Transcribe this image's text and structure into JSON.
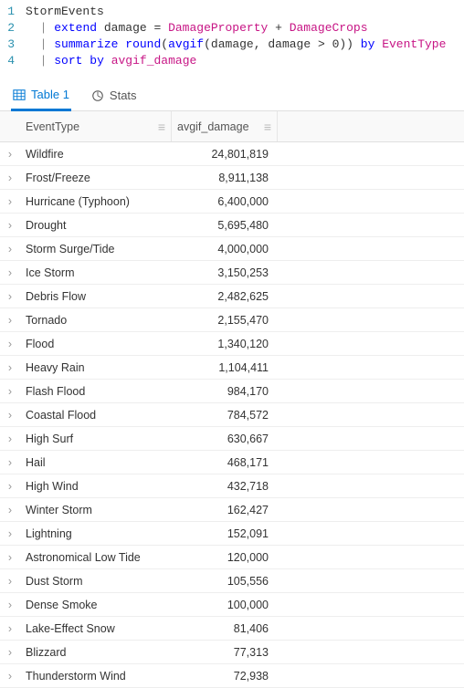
{
  "code": {
    "lines": [
      {
        "num": "1",
        "tokens": [
          {
            "t": "StormEvents",
            "c": "tok-table"
          }
        ]
      },
      {
        "num": "2",
        "tokens": [
          {
            "t": "  ",
            "c": ""
          },
          {
            "t": "|",
            "c": "tok-pipe"
          },
          {
            "t": " ",
            "c": ""
          },
          {
            "t": "extend",
            "c": "tok-kw"
          },
          {
            "t": " ",
            "c": ""
          },
          {
            "t": "damage",
            "c": "tok-param"
          },
          {
            "t": " = ",
            "c": "tok-op"
          },
          {
            "t": "DamageProperty",
            "c": "tok-col"
          },
          {
            "t": " + ",
            "c": "tok-op"
          },
          {
            "t": "DamageCrops",
            "c": "tok-col"
          }
        ]
      },
      {
        "num": "3",
        "tokens": [
          {
            "t": "  ",
            "c": ""
          },
          {
            "t": "|",
            "c": "tok-pipe"
          },
          {
            "t": " ",
            "c": ""
          },
          {
            "t": "summarize",
            "c": "tok-kw"
          },
          {
            "t": " ",
            "c": ""
          },
          {
            "t": "round",
            "c": "tok-fn"
          },
          {
            "t": "(",
            "c": "tok-op"
          },
          {
            "t": "avgif",
            "c": "tok-fn"
          },
          {
            "t": "(",
            "c": "tok-op"
          },
          {
            "t": "damage",
            "c": "tok-param"
          },
          {
            "t": ", ",
            "c": "tok-op"
          },
          {
            "t": "damage",
            "c": "tok-param"
          },
          {
            "t": " > ",
            "c": "tok-op"
          },
          {
            "t": "0",
            "c": "tok-num"
          },
          {
            "t": ")) ",
            "c": "tok-op"
          },
          {
            "t": "by",
            "c": "tok-by"
          },
          {
            "t": " ",
            "c": ""
          },
          {
            "t": "EventType",
            "c": "tok-col"
          }
        ]
      },
      {
        "num": "4",
        "tokens": [
          {
            "t": "  ",
            "c": ""
          },
          {
            "t": "|",
            "c": "tok-pipe"
          },
          {
            "t": " ",
            "c": ""
          },
          {
            "t": "sort",
            "c": "tok-kw"
          },
          {
            "t": " ",
            "c": ""
          },
          {
            "t": "by",
            "c": "tok-by"
          },
          {
            "t": " ",
            "c": ""
          },
          {
            "t": "avgif_damage",
            "c": "tok-col"
          }
        ]
      }
    ]
  },
  "tabs": {
    "table_label": "Table 1",
    "stats_label": "Stats"
  },
  "columns": {
    "event": "EventType",
    "damage": "avgif_damage"
  },
  "rows": [
    {
      "event": "Wildfire",
      "damage": "24,801,819"
    },
    {
      "event": "Frost/Freeze",
      "damage": "8,911,138"
    },
    {
      "event": "Hurricane (Typhoon)",
      "damage": "6,400,000"
    },
    {
      "event": "Drought",
      "damage": "5,695,480"
    },
    {
      "event": "Storm Surge/Tide",
      "damage": "4,000,000"
    },
    {
      "event": "Ice Storm",
      "damage": "3,150,253"
    },
    {
      "event": "Debris Flow",
      "damage": "2,482,625"
    },
    {
      "event": "Tornado",
      "damage": "2,155,470"
    },
    {
      "event": "Flood",
      "damage": "1,340,120"
    },
    {
      "event": "Heavy Rain",
      "damage": "1,104,411"
    },
    {
      "event": "Flash Flood",
      "damage": "984,170"
    },
    {
      "event": "Coastal Flood",
      "damage": "784,572"
    },
    {
      "event": "High Surf",
      "damage": "630,667"
    },
    {
      "event": "Hail",
      "damage": "468,171"
    },
    {
      "event": "High Wind",
      "damage": "432,718"
    },
    {
      "event": "Winter Storm",
      "damage": "162,427"
    },
    {
      "event": "Lightning",
      "damage": "152,091"
    },
    {
      "event": "Astronomical Low Tide",
      "damage": "120,000"
    },
    {
      "event": "Dust Storm",
      "damage": "105,556"
    },
    {
      "event": "Dense Smoke",
      "damage": "100,000"
    },
    {
      "event": "Lake-Effect Snow",
      "damage": "81,406"
    },
    {
      "event": "Blizzard",
      "damage": "77,313"
    },
    {
      "event": "Thunderstorm Wind",
      "damage": "72,938"
    }
  ],
  "glyphs": {
    "menu": "≡",
    "chev": "›"
  }
}
